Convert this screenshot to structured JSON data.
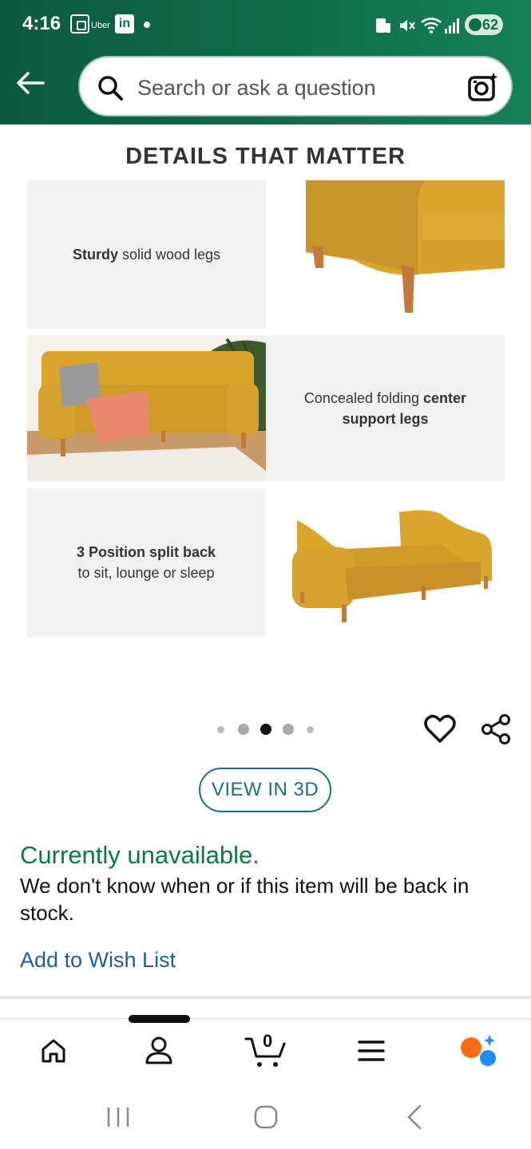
{
  "status_bar": {
    "time": "4:16",
    "uber_label": "Uber",
    "linkedin_label": "in",
    "battery": "62"
  },
  "header": {
    "search_placeholder": "Search or ask a question"
  },
  "details": {
    "title": "DETAILS THAT MATTER",
    "card1": {
      "bold": "Sturdy",
      "rest": " solid wood legs"
    },
    "card2": {
      "pre": "Concealed folding ",
      "bold1": "center",
      "bold2": "support legs"
    },
    "card3": {
      "bold": "3 Position split back",
      "rest": "to sit, lounge or sleep"
    }
  },
  "carousel": {
    "dot_count": 5,
    "active_index": 2
  },
  "actions": {
    "view_3d": "VIEW IN 3D"
  },
  "availability": {
    "status": "Currently unavailable.",
    "message": "We don't know when or if this item will be back in stock.",
    "wishlist": "Add to Wish List"
  },
  "bottom_nav": {
    "cart_count": "0",
    "items": [
      "home-icon",
      "account-icon",
      "cart-icon",
      "menu-icon",
      "ai-assistant-icon"
    ]
  },
  "colors": {
    "header_green": "#0f6d4b",
    "unavailable_green": "#0b7a3e",
    "link_blue": "#1f5f8b",
    "mustard": "#d9a52b"
  }
}
